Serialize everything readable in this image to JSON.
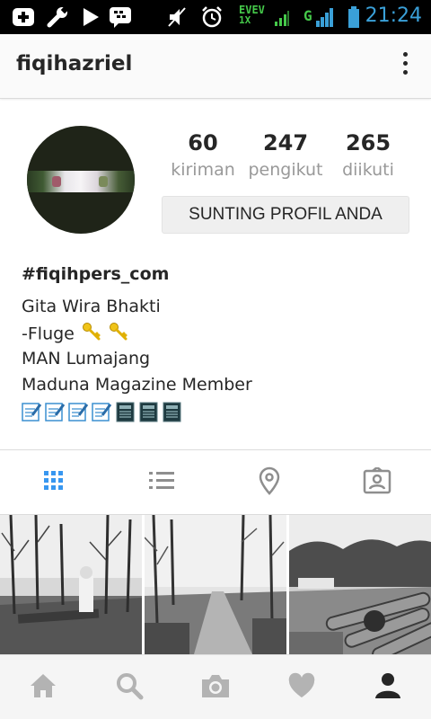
{
  "status_bar": {
    "time": "21:24",
    "network_top": "EVEV",
    "network_bottom": "1X",
    "signal_label": "G",
    "icons": [
      "add-icon",
      "wrench-icon",
      "play-store-icon",
      "bbm-icon",
      "mute-icon",
      "alarm-icon",
      "signal-icon",
      "battery-icon"
    ]
  },
  "header": {
    "username": "fiqihazriel",
    "menu_icon": "more-vertical-icon"
  },
  "profile": {
    "stats": [
      {
        "value": "60",
        "label": "kiriman"
      },
      {
        "value": "247",
        "label": "pengikut"
      },
      {
        "value": "265",
        "label": "diikuti"
      }
    ],
    "edit_button": "SUNTING PROFIL ANDA",
    "bio_name": "#fiqihpers_com",
    "bio_lines": [
      "Gita Wira Bhakti",
      "-Fluge",
      "MAN Lumajang",
      "Maduna Magazine Member"
    ],
    "emoji_icons": [
      "memo-icon",
      "memo-icon",
      "memo-icon",
      "memo-icon",
      "newspaper-icon",
      "newspaper-icon",
      "newspaper-icon"
    ]
  },
  "tabs": [
    {
      "icon": "grid-view-icon",
      "active": true
    },
    {
      "icon": "list-view-icon",
      "active": false
    },
    {
      "icon": "location-pin-icon",
      "active": false
    },
    {
      "icon": "tagged-photos-icon",
      "active": false
    }
  ],
  "bottom_nav": [
    {
      "icon": "home-icon"
    },
    {
      "icon": "search-icon"
    },
    {
      "icon": "camera-icon"
    },
    {
      "icon": "heart-icon"
    },
    {
      "icon": "profile-icon",
      "active": true
    }
  ],
  "colors": {
    "accent_blue": "#3897f0",
    "status_time": "#3aa0d8",
    "muted_text": "#999999",
    "icon_gray": "#8e8e8e"
  }
}
